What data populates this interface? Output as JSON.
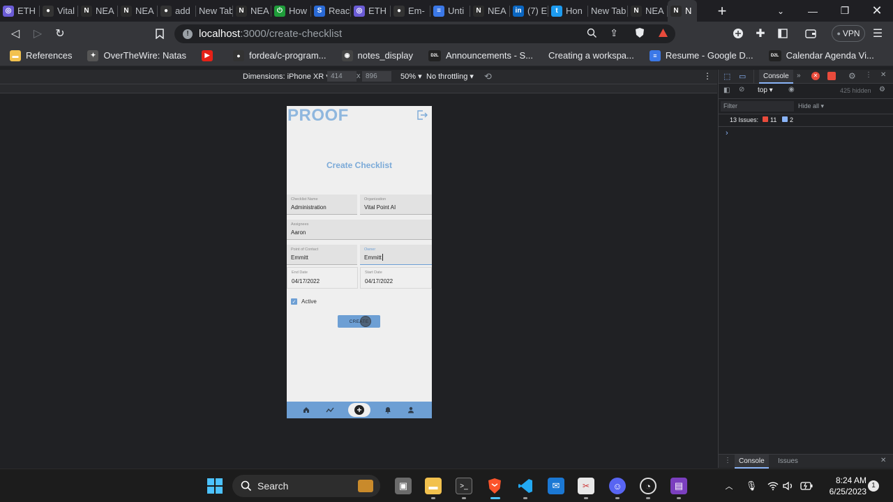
{
  "tabs": [
    {
      "label": "ETH",
      "color": "#6b5cd6",
      "glyph": "◎"
    },
    {
      "label": "Vital",
      "color": "#333",
      "glyph": "●"
    },
    {
      "label": "NEA",
      "color": "#2b2b2b",
      "glyph": "N"
    },
    {
      "label": "NEA",
      "color": "#2b2b2b",
      "glyph": "N"
    },
    {
      "label": "add",
      "color": "#333",
      "glyph": "●"
    },
    {
      "label": "New Tab",
      "color": "",
      "glyph": ""
    },
    {
      "label": "NEA",
      "color": "#2b2b2b",
      "glyph": "N"
    },
    {
      "label": "How",
      "color": "#1f9d3a",
      "glyph": "⏻"
    },
    {
      "label": "Reac",
      "color": "#2a6ad6",
      "glyph": "S"
    },
    {
      "label": "ETH",
      "color": "#6b5cd6",
      "glyph": "◎"
    },
    {
      "label": "Em-",
      "color": "#333",
      "glyph": "●"
    },
    {
      "label": "Unti",
      "color": "#3b78e7",
      "glyph": "≡"
    },
    {
      "label": "NEA",
      "color": "#2b2b2b",
      "glyph": "N"
    },
    {
      "label": "(7) E",
      "color": "#0a66c2",
      "glyph": "in"
    },
    {
      "label": "Hon",
      "color": "#1d9bf0",
      "glyph": "t"
    },
    {
      "label": "New Tab",
      "color": "",
      "glyph": ""
    },
    {
      "label": "NEA",
      "color": "#2b2b2b",
      "glyph": "N"
    },
    {
      "label": "N",
      "color": "#2b2b2b",
      "glyph": "N"
    }
  ],
  "url": {
    "host": "localhost",
    "path": ":3000/create-checklist"
  },
  "vpn_label": "VPN",
  "bookmarks": [
    {
      "label": "References",
      "color": "#f2c14e",
      "glyph": "▬"
    },
    {
      "label": "OverTheWire: Natas",
      "color": "#555",
      "glyph": "✦"
    },
    {
      "label": "",
      "color": "#e62117",
      "glyph": "▶"
    },
    {
      "label": "fordea/c-program...",
      "color": "#333",
      "glyph": "●"
    },
    {
      "label": "notes_display",
      "color": "#444",
      "glyph": "◉"
    },
    {
      "label": "Announcements - S...",
      "color": "#222",
      "glyph": "D2L"
    },
    {
      "label": "Creating a workspa...",
      "color": "",
      "glyph": ""
    },
    {
      "label": "Resume - Google D...",
      "color": "#3b78e7",
      "glyph": "≡"
    },
    {
      "label": "Calendar Agenda Vi...",
      "color": "#222",
      "glyph": "D2L"
    }
  ],
  "device": {
    "dimensions_label": "Dimensions: iPhone XR",
    "width": "414",
    "height": "896",
    "times": "x",
    "zoom": "50%",
    "throttling": "No throttling"
  },
  "app": {
    "logo": "PROOF",
    "title": "Create Checklist",
    "fields": {
      "checklist_name": {
        "label": "Checklist Name",
        "value": "Administration"
      },
      "organization": {
        "label": "Organization",
        "value": "Vital Point AI"
      },
      "assignees": {
        "label": "Assignees",
        "value": "Aaron"
      },
      "point_of_contact": {
        "label": "Point of Contact",
        "value": "Emmitt"
      },
      "owner": {
        "label": "Owner",
        "value": "Emmitt"
      },
      "end_date": {
        "label": "End Date",
        "value": "04/17/2022"
      },
      "start_date": {
        "label": "Start Date",
        "value": "04/17/2022"
      }
    },
    "active_label": "Active",
    "active_checked": true,
    "create_label": "CREATE"
  },
  "devtools": {
    "tab_console": "Console",
    "context": "top",
    "hidden_count": "425 hidden",
    "filter_placeholder": "Filter",
    "hide_all": "Hide all",
    "issues_label": "13 Issues:",
    "issues_errors": "11",
    "issues_info": "2",
    "prompt": "›",
    "bottom_console": "Console",
    "bottom_issues": "Issues"
  },
  "taskbar": {
    "search_label": "Search",
    "time": "8:24 AM",
    "date": "6/25/2023",
    "notification_count": "1"
  }
}
